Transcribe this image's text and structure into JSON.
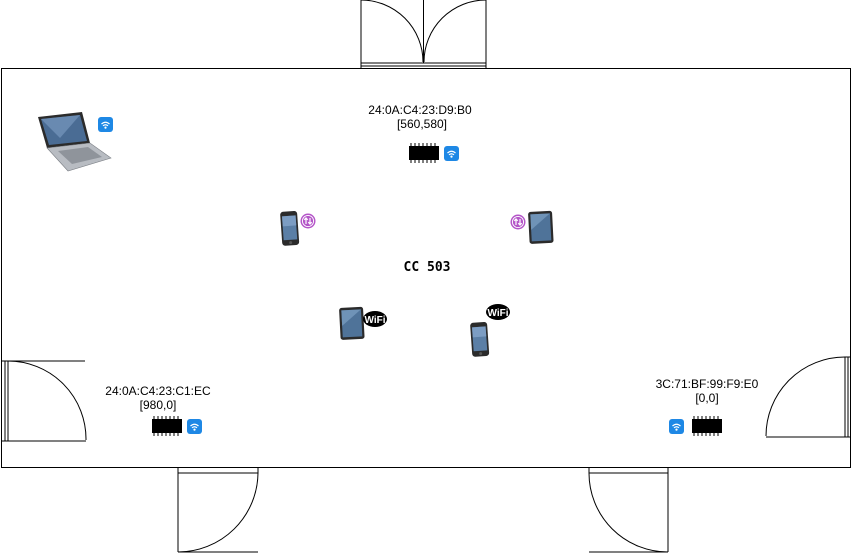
{
  "room": {
    "name": "CC 503"
  },
  "anchors": [
    {
      "mac": "24:0A:C4:23:D9:B0",
      "coords": "[560,580]"
    },
    {
      "mac": "24:0A:C4:23:C1:EC",
      "coords": "[980,0]"
    },
    {
      "mac": "3C:71:BF:99:F9:E0",
      "coords": "[0,0]"
    }
  ],
  "devices": [
    {
      "type": "laptop",
      "badge": "wifi-icon"
    },
    {
      "type": "phone",
      "badge": "data-transfer-icon"
    },
    {
      "type": "tablet",
      "badge": "data-transfer-icon"
    },
    {
      "type": "tablet",
      "badge": "wifi-logo"
    },
    {
      "type": "phone",
      "badge": "wifi-logo"
    }
  ],
  "wifi_badge_text": "WiFi",
  "colors": {
    "wall": "#000000",
    "wifi_badge": "#1e88e5",
    "transfer_badge": "#b455c8",
    "chip": "#000000"
  }
}
